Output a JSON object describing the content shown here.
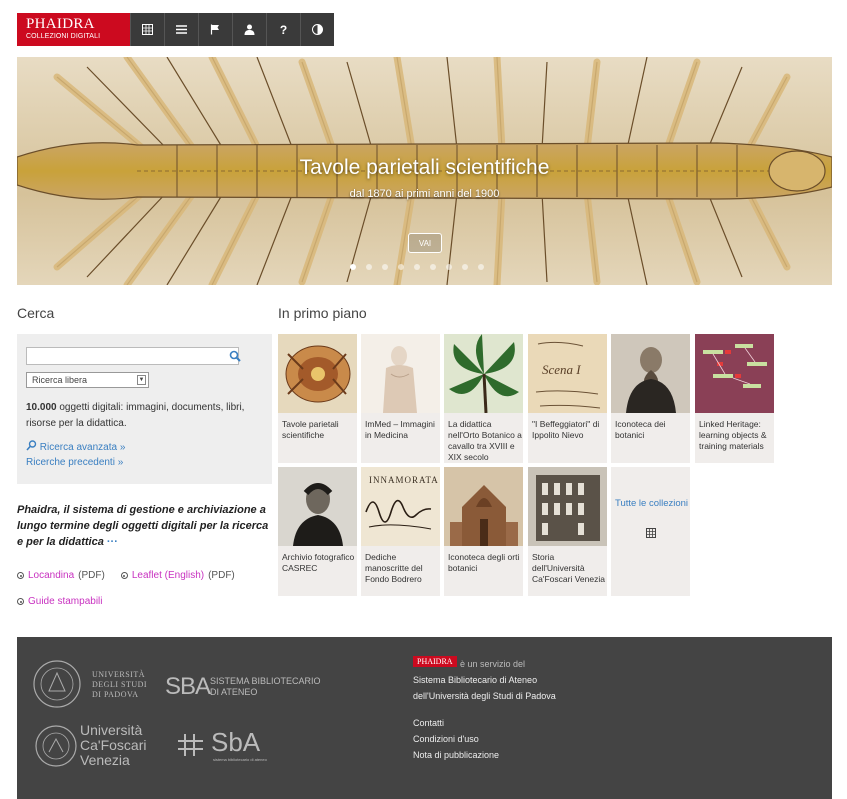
{
  "nav": {
    "logo_title": "PHAIDRA",
    "logo_subtitle": "COLLEZIONI DIGITALI",
    "buttons": [
      "grid-icon",
      "list-icon",
      "flag-icon",
      "user-icon",
      "help-icon",
      "contrast-icon"
    ],
    "help_glyph": "?"
  },
  "hero": {
    "title": "Tavole parietali scientifiche",
    "subtitle": "dal 1870 ai primi anni del 1900",
    "button_label": "VAI",
    "slide_count": 9,
    "active_slide": 1
  },
  "search": {
    "heading": "Cerca",
    "input_value": "",
    "select_value": "Ricerca libera",
    "count": "10.000",
    "count_text": " oggetti digitali: immagini, documents, libri, risorse per la didattica.",
    "advanced_label": "Ricerca avanzata »",
    "previous_label": "Ricerche precedenti »"
  },
  "about": {
    "brand": "Phaidra",
    "text": ", il sistema di gestione e archiviazione a lungo termine degli oggetti digitali per la ricerca e per la didattica ",
    "more": "···"
  },
  "links": {
    "locandina": "Locandina",
    "locandina_fmt": "(PDF)",
    "leaflet": "Leaflet (English)",
    "leaflet_fmt": "(PDF)",
    "guide": "Guide stampabili"
  },
  "featured": {
    "heading": "In primo piano",
    "items": [
      {
        "caption": "Tavole parietali scientifiche"
      },
      {
        "caption": "ImMed – Immagini in Medicina"
      },
      {
        "caption": "La didattica nell'Orto Botanico a cavallo tra XVIII e XIX secolo"
      },
      {
        "caption": "\"I Beffeggiatori\" di Ippolito Nievo"
      },
      {
        "caption": "Iconoteca dei botanici"
      },
      {
        "caption": "Linked Heritage: learning objects & training materials"
      },
      {
        "caption": "Archivio fotografico CASREC"
      },
      {
        "caption": "Dediche manoscritte del Fondo Bodrero"
      },
      {
        "caption": "Iconoteca degli orti botanici"
      },
      {
        "caption": "Storia dell'Università Ca'Foscari Venezia"
      }
    ],
    "all_label": "Tutte le collezioni",
    "thumb_text": {
      "scena": "Scena I",
      "innamorata": "INNAMORATA"
    }
  },
  "footer": {
    "badge": "PHAIDRA",
    "service_line": "è un servizio del",
    "line2": "Sistema Bibliotecario di Ateneo",
    "line3": "dell'Università degli Studi di Padova",
    "contatti": "Contatti",
    "condizioni": "Condizioni d'uso",
    "nota": "Nota di pubblicazione",
    "padova_1": "UNIVERSITÀ",
    "padova_2": "DEGLI STUDI",
    "padova_3": "DI PADOVA",
    "sba_mark": "SBA",
    "sba_1": "SISTEMA BIBLIOTECARIO",
    "sba_2": "DI ATENEO",
    "cf_1": "Università",
    "cf_2": "Ca'Foscari",
    "cf_3": "Venezia",
    "sba2_mark": "SbA",
    "sba2_sub": "sistema bibliotecario di ateneo"
  },
  "colors": {
    "brand_red": "#cc0a1f",
    "nav_dark": "#3a3a3a",
    "link_blue": "#3a7fc1",
    "link_magenta": "#c832c0",
    "footer_bg": "#444444"
  }
}
